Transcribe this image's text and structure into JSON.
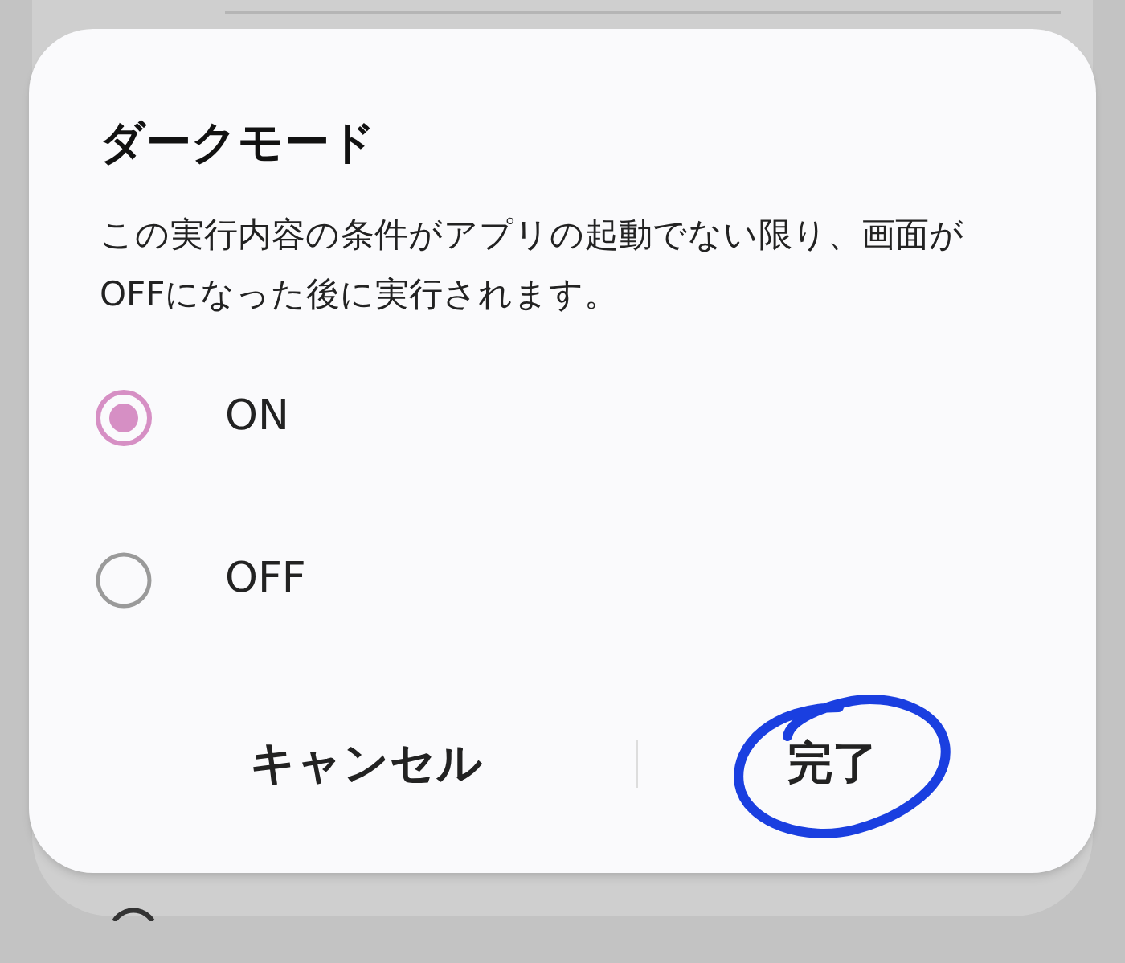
{
  "dialog": {
    "title": "ダークモード",
    "message": "この実行内容の条件がアプリの起動でない限り、画面がOFFになった後に実行されます。",
    "options": [
      {
        "label": "ON",
        "selected": true
      },
      {
        "label": "OFF",
        "selected": false
      }
    ],
    "buttons": [
      {
        "label": "キャンセル",
        "kind": "cancel"
      },
      {
        "label": "完了",
        "kind": "confirm",
        "circled": true
      }
    ]
  }
}
